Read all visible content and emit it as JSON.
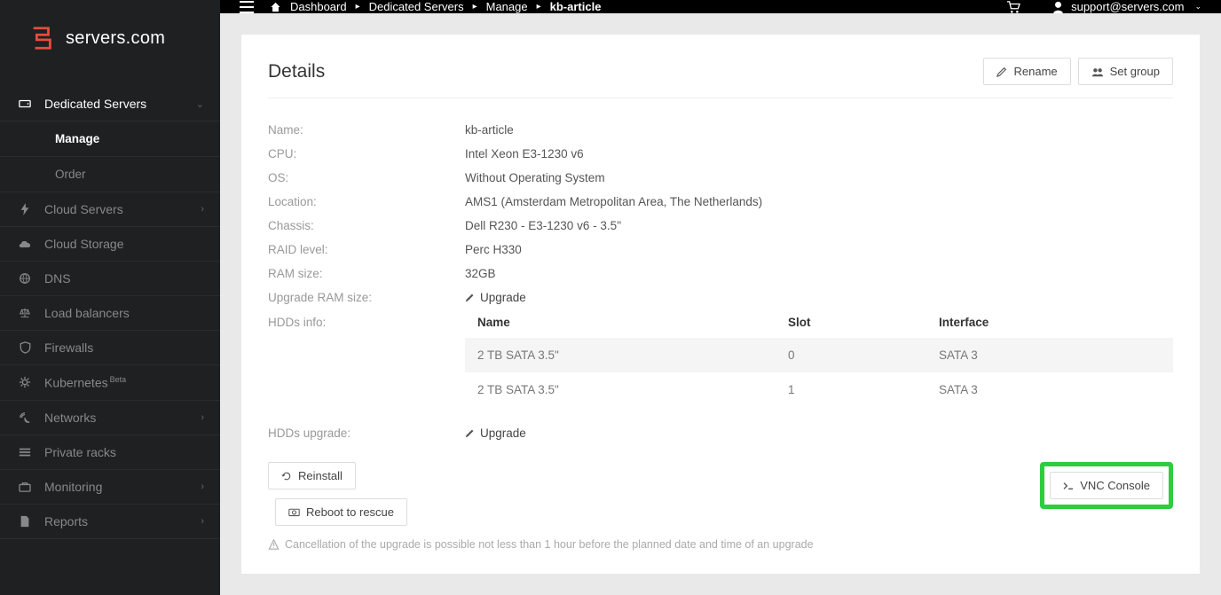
{
  "brand": {
    "name": "servers.com"
  },
  "sidebar": {
    "items": [
      {
        "label": "Dedicated Servers",
        "icon": "hdd",
        "expanded": true,
        "children": [
          {
            "label": "Manage",
            "active": true
          },
          {
            "label": "Order",
            "active": false
          }
        ]
      },
      {
        "label": "Cloud Servers",
        "icon": "bolt",
        "expandable": true
      },
      {
        "label": "Cloud Storage",
        "icon": "cloud"
      },
      {
        "label": "DNS",
        "icon": "globe"
      },
      {
        "label": "Load balancers",
        "icon": "scales"
      },
      {
        "label": "Firewalls",
        "icon": "shield"
      },
      {
        "label": "Kubernetes",
        "icon": "gear",
        "badge": "Beta"
      },
      {
        "label": "Networks",
        "icon": "signal",
        "expandable": true
      },
      {
        "label": "Private racks",
        "icon": "list"
      },
      {
        "label": "Monitoring",
        "icon": "briefcase",
        "expandable": true
      },
      {
        "label": "Reports",
        "icon": "file",
        "expandable": true
      }
    ]
  },
  "topbar": {
    "breadcrumb": [
      "Dashboard",
      "Dedicated Servers",
      "Manage",
      "kb-article"
    ],
    "user": "support@servers.com"
  },
  "details": {
    "heading": "Details",
    "rename_btn": "Rename",
    "setgroup_btn": "Set group",
    "rows": {
      "name_label": "Name:",
      "name_value": "kb-article",
      "cpu_label": "CPU:",
      "cpu_value": "Intel Xeon E3-1230 v6",
      "os_label": "OS:",
      "os_value": "Without Operating System",
      "location_label": "Location:",
      "location_value": "AMS1 (Amsterdam Metropolitan Area, The Netherlands)",
      "chassis_label": "Chassis:",
      "chassis_value": "Dell R230 - E3-1230 v6 - 3.5''",
      "raid_label": "RAID level:",
      "raid_value": "Perc H330",
      "ram_label": "RAM size:",
      "ram_value": "32GB",
      "ramupgrade_label": "Upgrade RAM size:",
      "upgrade_link": "Upgrade",
      "hdds_label": "HDDs info:",
      "hddsupgrade_label": "HDDs upgrade:"
    },
    "hdd_table": {
      "cols": {
        "name": "Name",
        "slot": "Slot",
        "iface": "Interface"
      },
      "rows": [
        {
          "name": "2 TB SATA 3.5\"",
          "slot": "0",
          "iface": "SATA 3"
        },
        {
          "name": "2 TB SATA 3.5\"",
          "slot": "1",
          "iface": "SATA 3"
        }
      ]
    },
    "reinstall_btn": "Reinstall",
    "reboot_btn": "Reboot to rescue",
    "vnc_btn": "VNC Console",
    "note": "Cancellation of the upgrade is possible not less than 1 hour before the planned date and time of an upgrade"
  }
}
